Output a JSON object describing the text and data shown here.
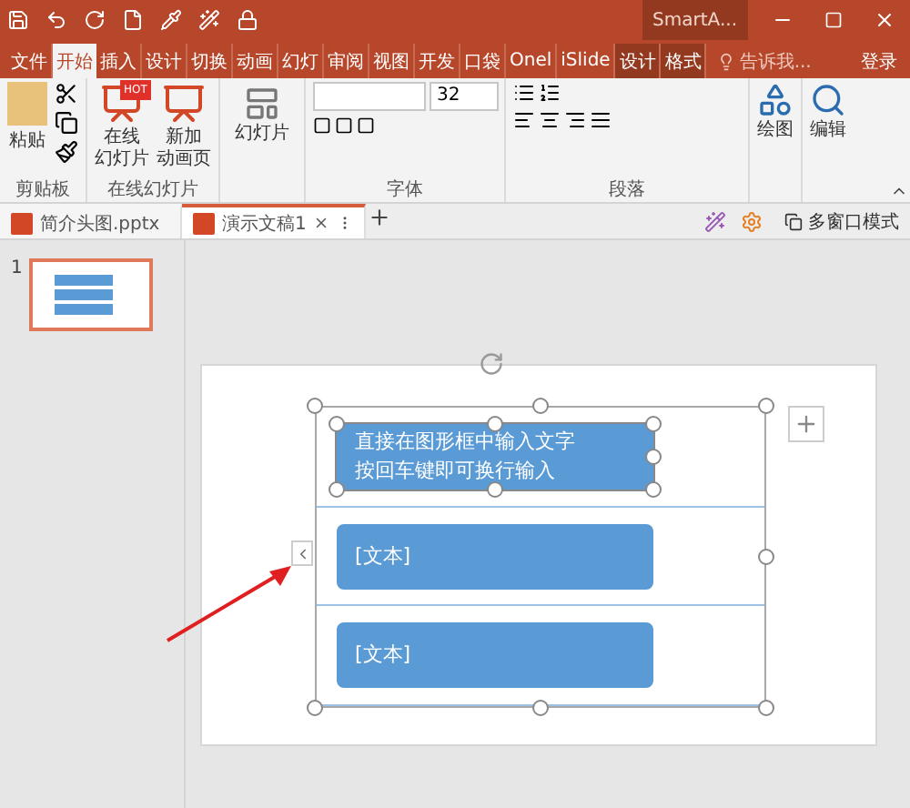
{
  "title_bar": {
    "title": "SmartA..."
  },
  "ribbon_tabs": [
    {
      "label": "文件",
      "selected": false,
      "kind": "normal"
    },
    {
      "label": "开始",
      "selected": true,
      "kind": "normal"
    },
    {
      "label": "插入",
      "selected": false,
      "kind": "normal"
    },
    {
      "label": "设计",
      "selected": false,
      "kind": "normal"
    },
    {
      "label": "切换",
      "selected": false,
      "kind": "normal"
    },
    {
      "label": "动画",
      "selected": false,
      "kind": "normal"
    },
    {
      "label": "幻灯",
      "selected": false,
      "kind": "normal"
    },
    {
      "label": "审阅",
      "selected": false,
      "kind": "normal"
    },
    {
      "label": "视图",
      "selected": false,
      "kind": "normal"
    },
    {
      "label": "开发",
      "selected": false,
      "kind": "normal"
    },
    {
      "label": "口袋",
      "selected": false,
      "kind": "normal"
    },
    {
      "label": "Onel",
      "selected": false,
      "kind": "normal"
    },
    {
      "label": "iSlide",
      "selected": false,
      "kind": "normal"
    },
    {
      "label": "设计",
      "selected": false,
      "kind": "context"
    },
    {
      "label": "格式",
      "selected": false,
      "kind": "context"
    }
  ],
  "tell_me": "告诉我...",
  "sign_in": "登录",
  "clipboard": {
    "paste": "粘贴",
    "label": "剪贴板"
  },
  "online": {
    "buttons": [
      {
        "lines": [
          "在线",
          "幻灯片"
        ],
        "badge": "HOT"
      },
      {
        "lines": [
          "新加",
          "动画页"
        ]
      }
    ],
    "label": "在线幻灯片"
  },
  "slides_group": {
    "button": "幻灯片"
  },
  "font": {
    "size": "32",
    "label": "字体"
  },
  "paragraph": {
    "label": "段落"
  },
  "drawing": {
    "button": "绘图"
  },
  "editing": {
    "button": "编辑"
  },
  "doc_tabs": [
    {
      "label": "简介头图.pptx",
      "selected": false
    },
    {
      "label": "演示文稿1",
      "selected": true
    }
  ],
  "multi_window": "多窗口模式",
  "thumbnails": [
    {
      "number": "1",
      "selected": true
    }
  ],
  "smartart": {
    "items": [
      {
        "text": "直接在图形框中输入文字按回车键即可换行输入",
        "selected": true
      },
      {
        "text": "[文本]",
        "selected": false
      },
      {
        "text": "[文本]",
        "selected": false
      }
    ]
  }
}
